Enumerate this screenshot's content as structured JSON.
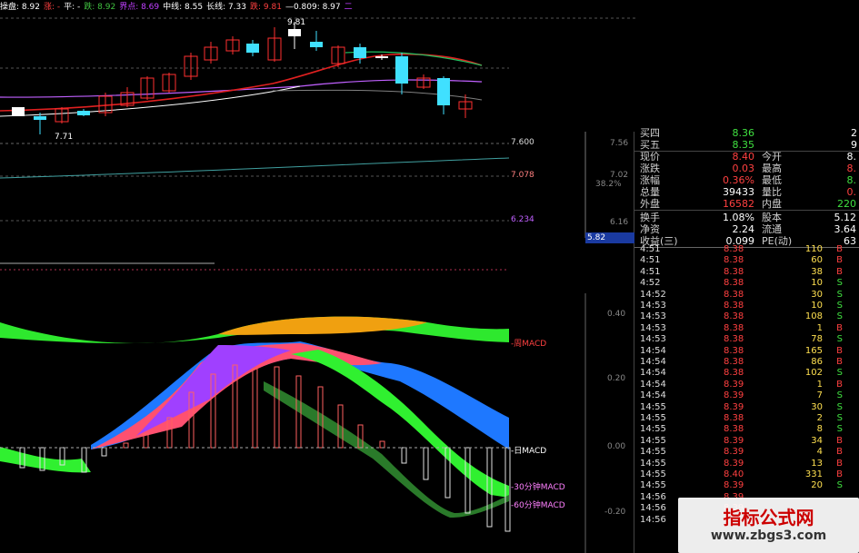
{
  "topbar": {
    "items": [
      {
        "text": "操盘: 8.92",
        "color": "#ffffff"
      },
      {
        "text": "涨: -",
        "color": "#ff4040"
      },
      {
        "text": "平: -",
        "color": "#ffffff"
      },
      {
        "text": "跌: 8.92",
        "color": "#40c040"
      },
      {
        "text": "界点: 8.69",
        "color": "#c040ff"
      },
      {
        "text": "中线: 8.55",
        "color": "#ffffff"
      },
      {
        "text": "长线: 7.33",
        "color": "#ffffff"
      },
      {
        "text": "跌: 9.81",
        "color": "#ff4040"
      },
      {
        "text": "—0.809: 8.97",
        "color": "#ffffff"
      },
      {
        "text": "二",
        "color": "#c040ff"
      }
    ]
  },
  "price_chart": {
    "high_label": "9.81",
    "low_label": "7.71",
    "levels": [
      "7.600",
      "7.078",
      "6.234"
    ]
  },
  "macd_panel": {
    "labels": [
      "周MACD",
      "日MACD",
      "30分钟MACD",
      "60分钟MACD"
    ],
    "axis": [
      "0.40",
      "0.20",
      "0.00",
      "-0.20"
    ],
    "ruler_labels": [
      "7.56",
      "7.02",
      "38.2%",
      "6.16",
      "5.82"
    ],
    "price_box": "5.82"
  },
  "quote": {
    "rows": [
      {
        "label": "买四",
        "value": "8.36",
        "vcolor": "#40e040",
        "extra": "2"
      },
      {
        "label": "买五",
        "value": "8.35",
        "vcolor": "#40e040",
        "extra": "9"
      },
      {
        "label": "现价",
        "value": "8.40",
        "vcolor": "#ff4040",
        "label2": "今开",
        "value2": "8.",
        "v2color": "#ffffff"
      },
      {
        "label": "涨跌",
        "value": "0.03",
        "vcolor": "#ff4040",
        "label2": "最高",
        "value2": "8.",
        "v2color": "#ff4040"
      },
      {
        "label": "涨幅",
        "value": "0.36%",
        "vcolor": "#ff4040",
        "label2": "最低",
        "value2": "8.",
        "v2color": "#40e040"
      },
      {
        "label": "总量",
        "value": "39433",
        "vcolor": "#ffffff",
        "label2": "量比",
        "value2": "0.",
        "v2color": "#ff4040"
      },
      {
        "label": "外盘",
        "value": "16582",
        "vcolor": "#ff4040",
        "label2": "内盘",
        "value2": "220",
        "v2color": "#40e040"
      },
      {
        "label": "换手",
        "value": "1.08%",
        "vcolor": "#ffffff",
        "label2": "股本",
        "value2": "5.12",
        "v2color": "#ffffff"
      },
      {
        "label": "净资",
        "value": "2.24",
        "vcolor": "#ffffff",
        "label2": "流通",
        "value2": "3.64",
        "v2color": "#ffffff"
      },
      {
        "label": "收益(三)",
        "value": "0.099",
        "vcolor": "#ffffff",
        "label2": "PE(动)",
        "value2": "63",
        "v2color": "#ffffff"
      }
    ]
  },
  "ticks": [
    {
      "time": "4:51",
      "price": "8.38",
      "vol": "110",
      "bs": "B"
    },
    {
      "time": "4:51",
      "price": "8.38",
      "vol": "60",
      "bs": "B"
    },
    {
      "time": "4:51",
      "price": "8.38",
      "vol": "38",
      "bs": "B"
    },
    {
      "time": "4:52",
      "price": "8.38",
      "vol": "10",
      "bs": "S"
    },
    {
      "time": "14:52",
      "price": "8.38",
      "vol": "30",
      "bs": "S"
    },
    {
      "time": "14:53",
      "price": "8.38",
      "vol": "10",
      "bs": "S"
    },
    {
      "time": "14:53",
      "price": "8.38",
      "vol": "108",
      "bs": "S"
    },
    {
      "time": "14:53",
      "price": "8.38",
      "vol": "1",
      "bs": "B"
    },
    {
      "time": "14:53",
      "price": "8.38",
      "vol": "78",
      "bs": "S"
    },
    {
      "time": "14:54",
      "price": "8.38",
      "vol": "165",
      "bs": "B"
    },
    {
      "time": "14:54",
      "price": "8.38",
      "vol": "86",
      "bs": "B"
    },
    {
      "time": "14:54",
      "price": "8.38",
      "vol": "102",
      "bs": "S"
    },
    {
      "time": "14:54",
      "price": "8.39",
      "vol": "1",
      "bs": "B"
    },
    {
      "time": "14:54",
      "price": "8.39",
      "vol": "7",
      "bs": "S"
    },
    {
      "time": "14:55",
      "price": "8.39",
      "vol": "30",
      "bs": "S"
    },
    {
      "time": "14:55",
      "price": "8.38",
      "vol": "2",
      "bs": "S"
    },
    {
      "time": "14:55",
      "price": "8.38",
      "vol": "8",
      "bs": "S"
    },
    {
      "time": "14:55",
      "price": "8.39",
      "vol": "34",
      "bs": "B"
    },
    {
      "time": "14:55",
      "price": "8.39",
      "vol": "4",
      "bs": "B"
    },
    {
      "time": "14:55",
      "price": "8.39",
      "vol": "13",
      "bs": "B"
    },
    {
      "time": "14:55",
      "price": "8.40",
      "vol": "331",
      "bs": "B"
    },
    {
      "time": "14:55",
      "price": "8.39",
      "vol": "20",
      "bs": "S"
    },
    {
      "time": "14:56",
      "price": "8.39",
      "vol": "",
      "bs": ""
    },
    {
      "time": "14:56",
      "price": "8.39",
      "vol": "",
      "bs": ""
    },
    {
      "time": "14:56",
      "price": "8.39",
      "vol": "",
      "bs": ""
    }
  ],
  "watermark": {
    "title": "指标公式网",
    "url": "www.zbgs3.com"
  }
}
